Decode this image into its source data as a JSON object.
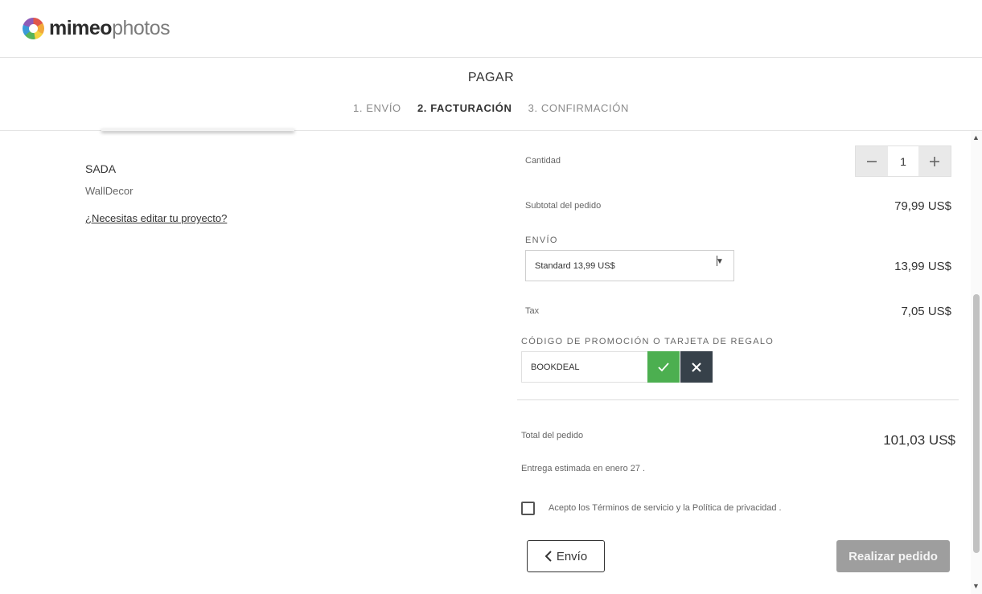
{
  "header": {
    "logo_bold": "mimeo",
    "logo_light": "photos"
  },
  "checkout": {
    "title": "PAGAR",
    "steps": [
      "1. ENVÍO",
      "2. FACTURACIÓN",
      "3. CONFIRMACIÓN"
    ],
    "active_step": "2. FACTURACIÓN"
  },
  "project": {
    "name": "SADA",
    "type": "WallDecor",
    "edit_link": "¿Necesitas editar tu proyecto?"
  },
  "summary": {
    "quantity_label": "Cantidad",
    "quantity_value": "1",
    "subtotal_label": "Subtotal del pedido",
    "subtotal_value": "79,99 US$",
    "shipping_label": "ENVÍO",
    "shipping_selected": "Standard 13,99 US$",
    "shipping_value": "13,99 US$",
    "tax_label": "Tax",
    "tax_value": "7,05 US$",
    "promo_label": "CÓDIGO DE PROMOCIÓN O TARJETA DE REGALO",
    "promo_code": "BOOKDEAL",
    "total_label": "Total del pedido",
    "total_value": "101,03 US$",
    "delivery_text": "Entrega estimada en enero 27 .",
    "terms_text": "Acepto los Términos de servicio y la Política de privacidad .",
    "terms_checked": false
  },
  "actions": {
    "back_label": "Envío",
    "place_order_label": "Realizar pedido"
  },
  "colors": {
    "apply_green": "#4caf50",
    "clear_dark": "#37414a",
    "disabled_button": "#9e9e9e"
  },
  "icons": {
    "minus": "minus-icon",
    "plus": "plus-icon",
    "check": "check-icon",
    "close": "close-icon",
    "chevron_left": "chevron-left-icon",
    "dropdown": "dropdown-caret-icon"
  }
}
